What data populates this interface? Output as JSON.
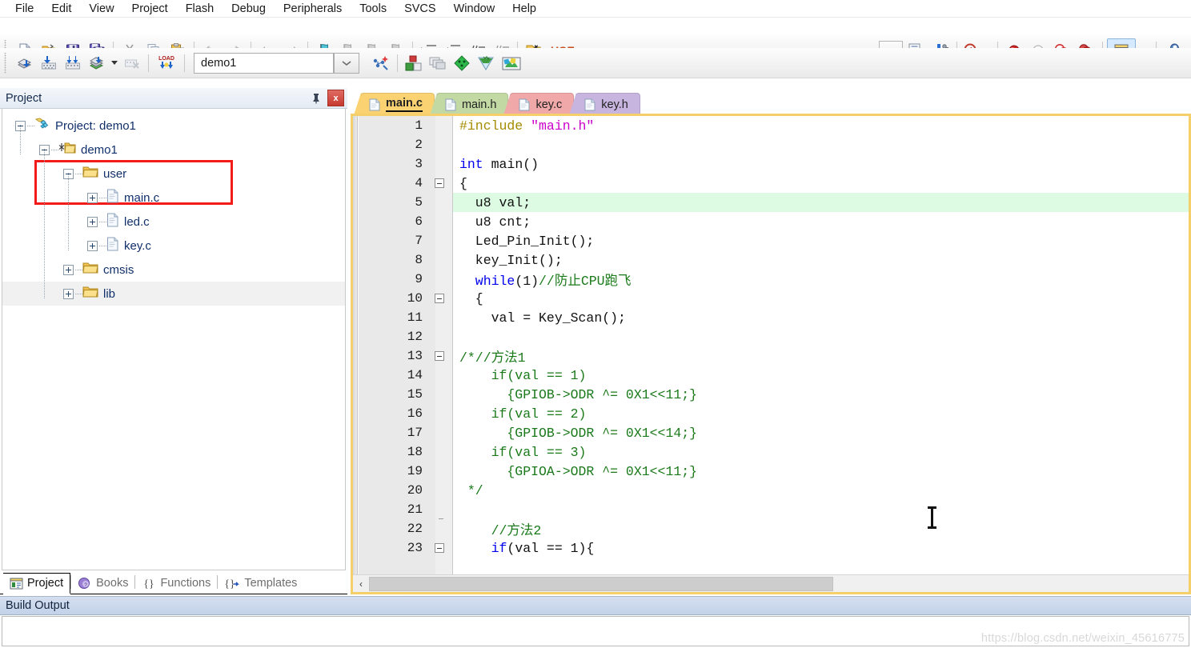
{
  "menu": {
    "items": [
      "File",
      "Edit",
      "View",
      "Project",
      "Flash",
      "Debug",
      "Peripherals",
      "Tools",
      "SVCS",
      "Window",
      "Help"
    ]
  },
  "toolbar_main": {
    "buttons": [
      {
        "name": "new-file-icon",
        "title": "New"
      },
      {
        "name": "open-file-icon",
        "title": "Open"
      },
      {
        "name": "save-icon",
        "title": "Save"
      },
      {
        "name": "save-all-icon",
        "title": "Save All"
      },
      {
        "name": "cut-icon",
        "title": "Cut"
      },
      {
        "name": "copy-icon",
        "title": "Copy"
      },
      {
        "name": "paste-icon",
        "title": "Paste"
      },
      {
        "name": "undo-icon",
        "title": "Undo"
      },
      {
        "name": "redo-icon",
        "title": "Redo"
      },
      {
        "name": "navigate-back-icon",
        "title": "Back"
      },
      {
        "name": "navigate-forward-icon",
        "title": "Forward"
      },
      {
        "name": "bookmark-toggle-icon",
        "title": "Insert/Remove Bookmark"
      },
      {
        "name": "bookmark-prev-icon",
        "title": "Previous Bookmark"
      },
      {
        "name": "bookmark-next-icon",
        "title": "Next Bookmark"
      },
      {
        "name": "bookmark-clear-icon",
        "title": "Clear All Bookmarks"
      },
      {
        "name": "indent-right-icon",
        "title": "Indent"
      },
      {
        "name": "indent-left-icon",
        "title": "Outdent"
      },
      {
        "name": "comment-icon",
        "title": "Comment Selection"
      },
      {
        "name": "uncomment-icon",
        "title": "Uncomment Selection"
      },
      {
        "name": "find-in-files-icon",
        "title": "Find in Files"
      }
    ],
    "use_label": "USE",
    "right_buttons": [
      {
        "name": "dropdown-empty-icon",
        "title": "Select"
      },
      {
        "name": "debug-session-icon",
        "title": "Start/Stop Debug Session"
      },
      {
        "name": "debug-run-icon",
        "title": "Run"
      },
      {
        "name": "find-symbol-icon",
        "title": "Find"
      },
      {
        "name": "breakpoint-insert-icon",
        "title": "Insert/Remove Breakpoint"
      },
      {
        "name": "breakpoint-disable-icon",
        "title": "Enable/Disable Breakpoint"
      },
      {
        "name": "breakpoint-disable-all-icon",
        "title": "Disable All Breakpoints"
      },
      {
        "name": "breakpoint-kill-all-icon",
        "title": "Kill All Breakpoints"
      },
      {
        "name": "window-manager-icon",
        "title": "Manage Windows"
      },
      {
        "name": "configure-icon",
        "title": "Configuration Wizard"
      }
    ]
  },
  "toolbar_build": {
    "buttons": [
      {
        "name": "translate-icon",
        "title": "Translate"
      },
      {
        "name": "build-icon",
        "title": "Build"
      },
      {
        "name": "rebuild-icon",
        "title": "Rebuild"
      },
      {
        "name": "batch-build-icon",
        "title": "Batch Build"
      },
      {
        "name": "stop-build-icon",
        "title": "Stop Build"
      },
      {
        "name": "download-icon",
        "title": "Download"
      }
    ],
    "target_value": "demo1",
    "right_buttons": [
      {
        "name": "target-options-icon",
        "title": "Target Options"
      },
      {
        "name": "manage-project-items-icon",
        "title": "Manage Project Items"
      },
      {
        "name": "multi-project-icon",
        "title": "Multi-Project"
      },
      {
        "name": "pack-installer-icon",
        "title": "Pack Installer"
      },
      {
        "name": "manage-run-env-icon",
        "title": "Manage Run-Time Environment"
      },
      {
        "name": "select-software-packs-icon",
        "title": "Select Software Packs"
      }
    ]
  },
  "project_panel": {
    "title": "Project",
    "pin_glyph": "⚐",
    "close_glyph": "x",
    "tree": [
      {
        "label": "Project: demo1",
        "icon": "project-icon",
        "depth": 0,
        "expander": "minus",
        "shaded": false
      },
      {
        "label": "demo1",
        "icon": "target-folder-icon",
        "depth": 1,
        "expander": "minus",
        "shaded": false
      },
      {
        "label": "user",
        "icon": "group-folder-icon",
        "depth": 2,
        "expander": "minus",
        "shaded": false
      },
      {
        "label": "main.c",
        "icon": "c-file-icon",
        "depth": 3,
        "expander": "plus",
        "shaded": false
      },
      {
        "label": "led.c",
        "icon": "c-file-icon",
        "depth": 3,
        "expander": "plus",
        "shaded": false
      },
      {
        "label": "key.c",
        "icon": "c-file-icon",
        "depth": 3,
        "expander": "plus",
        "shaded": false
      },
      {
        "label": "cmsis",
        "icon": "group-folder-icon",
        "depth": 2,
        "expander": "plus",
        "shaded": false
      },
      {
        "label": "lib",
        "icon": "group-folder-icon",
        "depth": 2,
        "expander": "plus",
        "shaded": true
      }
    ],
    "highlight_color": "#f31a1a"
  },
  "panel_tabs": [
    {
      "label": "Project",
      "icon": "project-tab-icon",
      "selected": true
    },
    {
      "label": "Books",
      "icon": "books-tab-icon",
      "selected": false
    },
    {
      "label": "Functions",
      "icon": "functions-tab-icon",
      "selected": false
    },
    {
      "label": "Templates",
      "icon": "templates-tab-icon",
      "selected": false
    }
  ],
  "editor_tabs": [
    {
      "label": "main.c",
      "selected": true,
      "color": "#fad272"
    },
    {
      "label": "main.h",
      "selected": false,
      "color": "#c3d9a4"
    },
    {
      "label": "key.c",
      "selected": false,
      "color": "#f0a8a8"
    },
    {
      "label": "key.h",
      "selected": false,
      "color": "#c7b5e0"
    }
  ],
  "code": {
    "highlight_line": 5,
    "lines": [
      {
        "n": 1,
        "fold": "none",
        "tokens": [
          {
            "t": "#include ",
            "c": "pp"
          },
          {
            "t": "\"main.h\"",
            "c": "st"
          }
        ]
      },
      {
        "n": 2,
        "fold": "none",
        "tokens": []
      },
      {
        "n": 3,
        "fold": "none",
        "tokens": [
          {
            "t": "int ",
            "c": "k"
          },
          {
            "t": "main()",
            "c": "pl"
          }
        ]
      },
      {
        "n": 4,
        "fold": "box",
        "tokens": [
          {
            "t": "{",
            "c": "pl"
          }
        ]
      },
      {
        "n": 5,
        "fold": "line",
        "tokens": [
          {
            "t": "  u8 val;",
            "c": "pl"
          }
        ]
      },
      {
        "n": 6,
        "fold": "line",
        "tokens": [
          {
            "t": "  u8 cnt;",
            "c": "pl"
          }
        ]
      },
      {
        "n": 7,
        "fold": "line",
        "tokens": [
          {
            "t": "  Led_Pin_Init();",
            "c": "pl"
          }
        ]
      },
      {
        "n": 8,
        "fold": "line",
        "tokens": [
          {
            "t": "  key_Init();",
            "c": "pl"
          }
        ]
      },
      {
        "n": 9,
        "fold": "line",
        "tokens": [
          {
            "t": "  while",
            "c": "k"
          },
          {
            "t": "(1)",
            "c": "pl"
          },
          {
            "t": "//防止CPU跑飞",
            "c": "cm"
          }
        ]
      },
      {
        "n": 10,
        "fold": "box",
        "tokens": [
          {
            "t": "  {",
            "c": "pl"
          }
        ]
      },
      {
        "n": 11,
        "fold": "line",
        "tokens": [
          {
            "t": "    val = Key_Scan();",
            "c": "pl"
          }
        ]
      },
      {
        "n": 12,
        "fold": "line",
        "tokens": []
      },
      {
        "n": 13,
        "fold": "box",
        "tokens": [
          {
            "t": "/*//方法1",
            "c": "cm"
          }
        ]
      },
      {
        "n": 14,
        "fold": "line",
        "tokens": [
          {
            "t": "    if(val == 1)",
            "c": "cm"
          }
        ]
      },
      {
        "n": 15,
        "fold": "line",
        "tokens": [
          {
            "t": "      {GPIOB->ODR ^= 0X1<<11;}",
            "c": "cm"
          }
        ]
      },
      {
        "n": 16,
        "fold": "line",
        "tokens": [
          {
            "t": "    if(val == 2)",
            "c": "cm"
          }
        ]
      },
      {
        "n": 17,
        "fold": "line",
        "tokens": [
          {
            "t": "      {GPIOB->ODR ^= 0X1<<14;}",
            "c": "cm"
          }
        ]
      },
      {
        "n": 18,
        "fold": "line",
        "tokens": [
          {
            "t": "    if(val == 3)",
            "c": "cm"
          }
        ]
      },
      {
        "n": 19,
        "fold": "line",
        "tokens": [
          {
            "t": "      {GPIOA->ODR ^= 0X1<<11;}",
            "c": "cm"
          }
        ]
      },
      {
        "n": 20,
        "fold": "line",
        "tokens": [
          {
            "t": " */",
            "c": "cm"
          }
        ]
      },
      {
        "n": 21,
        "fold": "tick",
        "tokens": []
      },
      {
        "n": 22,
        "fold": "line",
        "tokens": [
          {
            "t": "    //方法2",
            "c": "cm"
          }
        ]
      },
      {
        "n": 23,
        "fold": "box",
        "tokens": [
          {
            "t": "    if",
            "c": "k"
          },
          {
            "t": "(val == 1){",
            "c": "pl"
          }
        ]
      }
    ]
  },
  "build_output": {
    "title": "Build Output"
  },
  "watermark": "https://blog.csdn.net/weixin_45616775"
}
